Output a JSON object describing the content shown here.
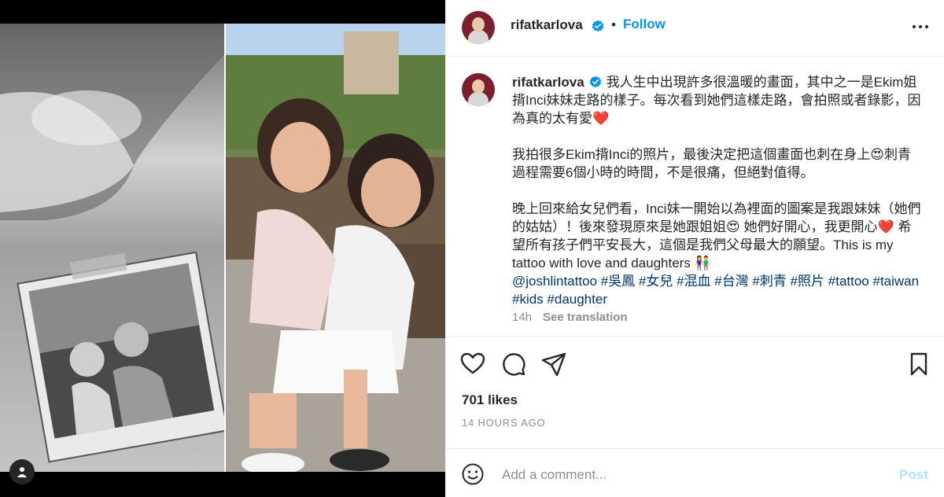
{
  "media": {
    "left_photo": "tattoo-photo",
    "right_photo": "kids-photo",
    "tag_icon": "user-icon"
  },
  "header": {
    "username": "rifatkarlova",
    "separator": "•",
    "follow_label": "Follow",
    "more_icon": "more-options-icon"
  },
  "caption": {
    "username": "rifatkarlova",
    "para1": "我人生中出現許多很溫暖的畫面，其中之一是Ekim姐揹Inci妹妹走路的樣子。每次看到她們這樣走路，會拍照或者錄影，因為真的太有愛❤️",
    "para2": "我拍很多Ekim揹Inci的照片，最後決定把這個畫面也刺在身上😍刺青過程需要6個小時的時間，不是很痛，但絕對值得。",
    "para3": "晚上回來給女兒們看，Inci妹一開始以為裡面的圖案是我跟妹妹（她們的姑姑）！後來發現原來是她跟姐姐😍 她們好開心，我更開心❤️ 希望所有孩子們平安長大，這個是我們父母最大的願望。This is my tattoo with love and daughters 👫",
    "hashtags": "@joshlintattoo #吳鳳 #女兒 #混血 #台灣 #刺青 #照片 #tattoo #taiwan #kids #daughter",
    "age": "14h",
    "see_translation": "See translation"
  },
  "actions": {
    "like_icon": "heart-icon",
    "comment_icon": "comment-icon",
    "share_icon": "share-icon",
    "save_icon": "bookmark-icon"
  },
  "likes": "701 likes",
  "timestamp": "14 HOURS AGO",
  "comment": {
    "placeholder": "Add a comment...",
    "post_label": "Post",
    "emoji_icon": "smiley-icon"
  },
  "colors": {
    "accent": "#0095f6",
    "post_disabled": "#b2dffc",
    "hashtag": "#00376b",
    "muted": "#8e8e8e",
    "verified": "#0095f6"
  }
}
